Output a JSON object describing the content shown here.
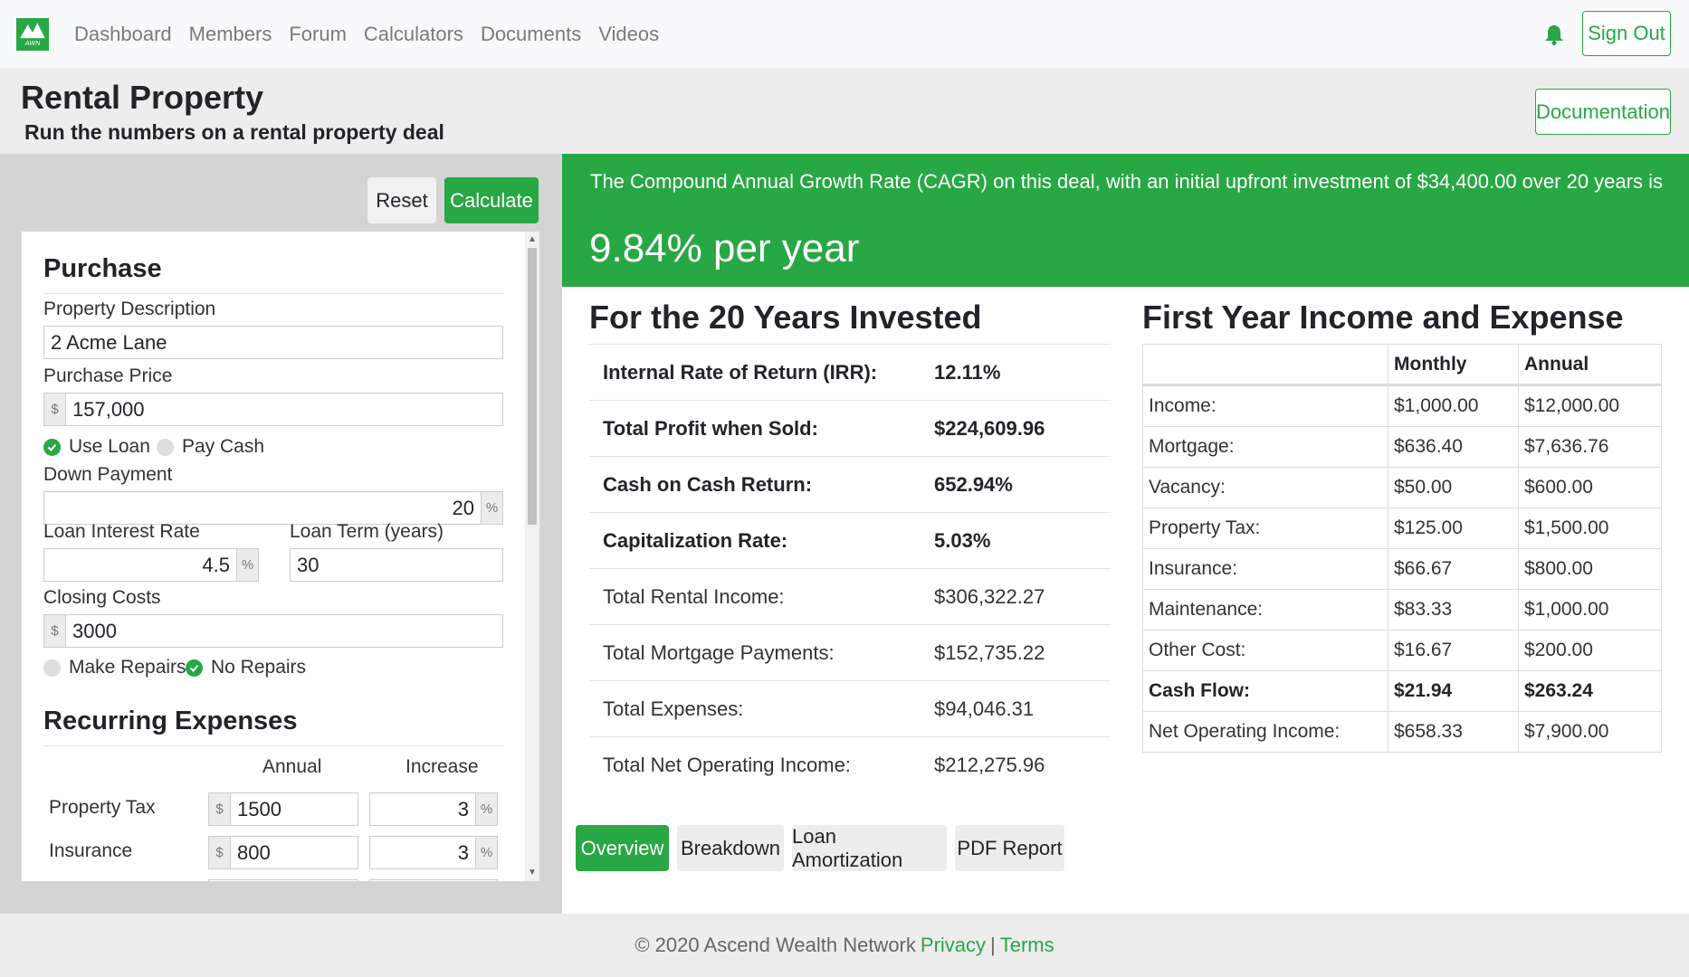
{
  "nav": {
    "logo_text": "AWN",
    "links": [
      "Dashboard",
      "Members",
      "Forum",
      "Calculators",
      "Documents",
      "Videos"
    ],
    "sign_out": "Sign Out"
  },
  "header": {
    "title": "Rental Property",
    "subtitle": "Run the numbers on a rental property deal",
    "documentation": "Documentation"
  },
  "form": {
    "reset": "Reset",
    "calculate": "Calculate",
    "purchase_title": "Purchase",
    "property_description_label": "Property Description",
    "property_description_value": "2 Acme Lane",
    "purchase_price_label": "Purchase Price",
    "purchase_price_value": "157,000",
    "currency_symbol": "$",
    "percent_symbol": "%",
    "use_loan": "Use Loan",
    "pay_cash": "Pay Cash",
    "financing_selected": "use_loan",
    "down_payment_label": "Down Payment",
    "down_payment_value": "20",
    "loan_rate_label": "Loan Interest Rate",
    "loan_rate_value": "4.5",
    "loan_term_label": "Loan Term (years)",
    "loan_term_value": "30",
    "closing_costs_label": "Closing Costs",
    "closing_costs_value": "3000",
    "make_repairs": "Make Repairs",
    "no_repairs": "No Repairs",
    "repairs_selected": "no_repairs",
    "recurring_title": "Recurring Expenses",
    "col_annual": "Annual",
    "col_increase": "Increase",
    "expenses": [
      {
        "label": "Property Tax",
        "annual": "1500",
        "increase": "3"
      },
      {
        "label": "Insurance",
        "annual": "800",
        "increase": "3"
      }
    ]
  },
  "banner": {
    "text": "The Compound Annual Growth Rate (CAGR) on this deal, with an initial upfront investment of $34,400.00 over 20 years is",
    "rate": "9.84% per year"
  },
  "summary": {
    "title": "For the 20 Years Invested",
    "rows": [
      {
        "label": "Internal Rate of Return (IRR):",
        "value": "12.11%",
        "bold": true
      },
      {
        "label": "Total Profit when Sold:",
        "value": "$224,609.96",
        "bold": true
      },
      {
        "label": "Cash on Cash Return:",
        "value": "652.94%",
        "bold": true
      },
      {
        "label": "Capitalization Rate:",
        "value": "5.03%",
        "bold": true
      },
      {
        "label": "Total Rental Income:",
        "value": "$306,322.27",
        "bold": false
      },
      {
        "label": "Total Mortgage Payments:",
        "value": "$152,735.22",
        "bold": false
      },
      {
        "label": "Total Expenses:",
        "value": "$94,046.31",
        "bold": false
      },
      {
        "label": "Total Net Operating Income:",
        "value": "$212,275.96",
        "bold": false
      }
    ]
  },
  "first_year": {
    "title": "First Year Income and Expense",
    "col_monthly": "Monthly",
    "col_annual": "Annual",
    "rows": [
      {
        "label": "Income:",
        "monthly": "$1,000.00",
        "annual": "$12,000.00",
        "bold": false
      },
      {
        "label": "Mortgage:",
        "monthly": "$636.40",
        "annual": "$7,636.76",
        "bold": false
      },
      {
        "label": "Vacancy:",
        "monthly": "$50.00",
        "annual": "$600.00",
        "bold": false
      },
      {
        "label": "Property Tax:",
        "monthly": "$125.00",
        "annual": "$1,500.00",
        "bold": false
      },
      {
        "label": "Insurance:",
        "monthly": "$66.67",
        "annual": "$800.00",
        "bold": false
      },
      {
        "label": "Maintenance:",
        "monthly": "$83.33",
        "annual": "$1,000.00",
        "bold": false
      },
      {
        "label": "Other Cost:",
        "monthly": "$16.67",
        "annual": "$200.00",
        "bold": false
      },
      {
        "label": "Cash Flow:",
        "monthly": "$21.94",
        "annual": "$263.24",
        "bold": true
      },
      {
        "label": "Net Operating Income:",
        "monthly": "$658.33",
        "annual": "$7,900.00",
        "bold": false
      }
    ]
  },
  "tabs": [
    {
      "label": "Overview",
      "active": true
    },
    {
      "label": "Breakdown",
      "active": false
    },
    {
      "label": "Loan Amortization",
      "active": false
    },
    {
      "label": "PDF Report",
      "active": false
    }
  ],
  "footer": {
    "copyright": "© 2020 Ascend Wealth Network",
    "privacy": "Privacy",
    "separator": "|",
    "terms": "Terms"
  },
  "colors": {
    "accent": "#28a745",
    "panel": "#d4d4d4",
    "header_bg": "#ededed"
  }
}
